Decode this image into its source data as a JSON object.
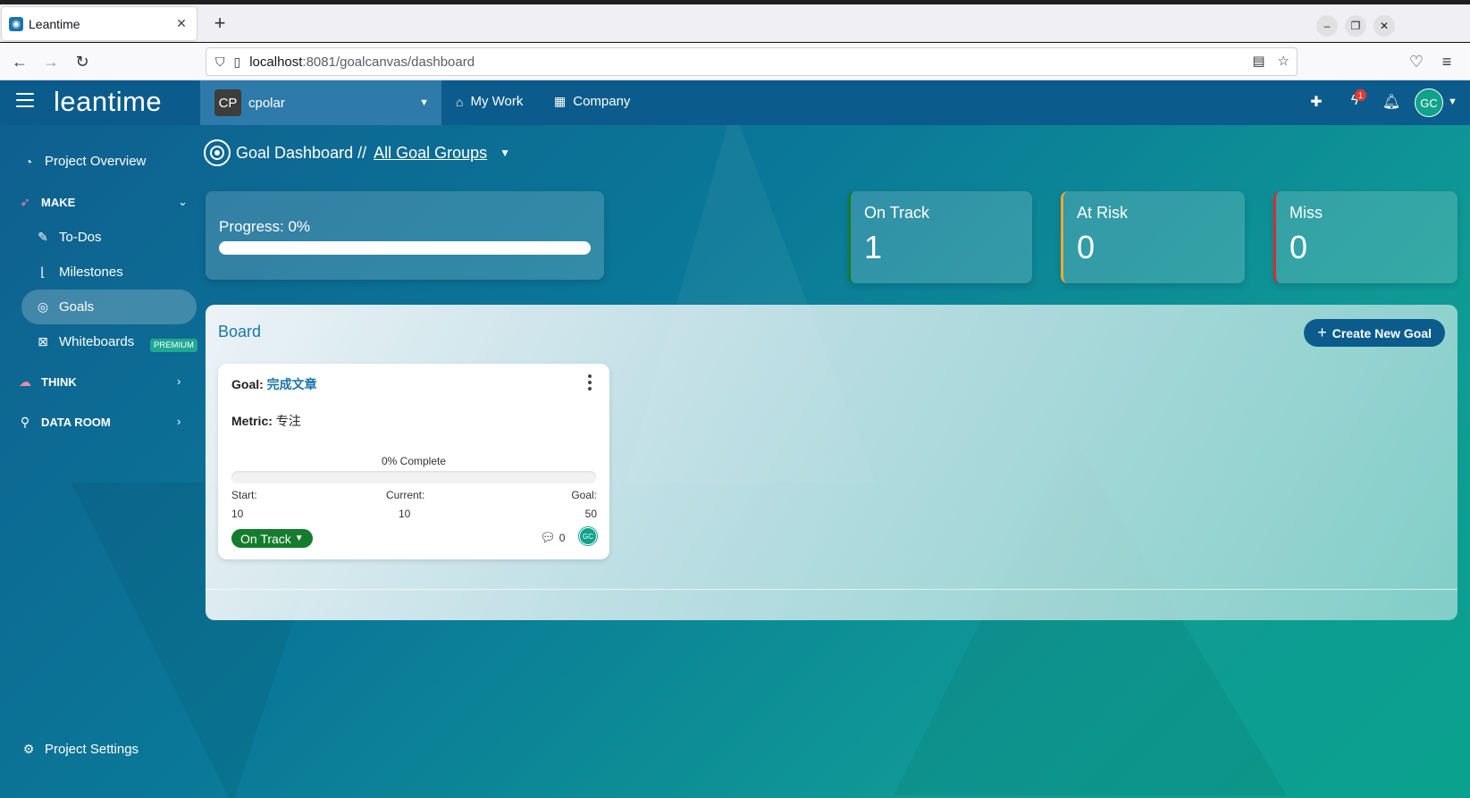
{
  "browser": {
    "tab_title": "Leantime",
    "tab_close": "✕",
    "new_tab": "+",
    "url_host": "localhost",
    "url_rest": ":8081/goalcanvas/dashboard"
  },
  "header": {
    "logo": "leantime",
    "project_initials": "CP",
    "project_name": "cpolar",
    "nav_my_work": "My Work",
    "nav_company": "Company",
    "notification_count": "1",
    "user_initials": "GC"
  },
  "sidebar": {
    "project_overview": "Project Overview",
    "make": "MAKE",
    "todos": "To-Dos",
    "milestones": "Milestones",
    "goals": "Goals",
    "whiteboards": "Whiteboards",
    "premium_badge": "PREMIUM",
    "think": "THINK",
    "data_room": "DATA ROOM",
    "project_settings": "Project Settings"
  },
  "page": {
    "title": "Goal Dashboard //",
    "group_filter": "All Goal Groups"
  },
  "progress": {
    "label": "Progress: 0%",
    "value": 0
  },
  "stats": {
    "on_track_label": "On Track",
    "on_track_value": "1",
    "at_risk_label": "At Risk",
    "at_risk_value": "0",
    "miss_label": "Miss",
    "miss_value": "0"
  },
  "board": {
    "title": "Board",
    "create_button": "Create New Goal",
    "goal_card": {
      "goal_prefix": "Goal:",
      "goal_name": "完成文章",
      "metric_prefix": "Metric:",
      "metric_value": "专注",
      "complete_label": "0% Complete",
      "complete_value": 0,
      "start_label": "Start:",
      "start_value": "10",
      "current_label": "Current:",
      "current_value": "10",
      "goal_label": "Goal:",
      "goal_value": "50",
      "status": "On Track",
      "comment_count": "0",
      "assignee_initials": "GC"
    }
  },
  "colors": {
    "header_bg": "#0b5c8c",
    "accent_blue": "#1b75a8",
    "on_track_green": "#157c2e",
    "at_risk_yellow": "#f0a830",
    "miss_red": "#d32f2f",
    "avatar_teal": "#10a28a"
  }
}
